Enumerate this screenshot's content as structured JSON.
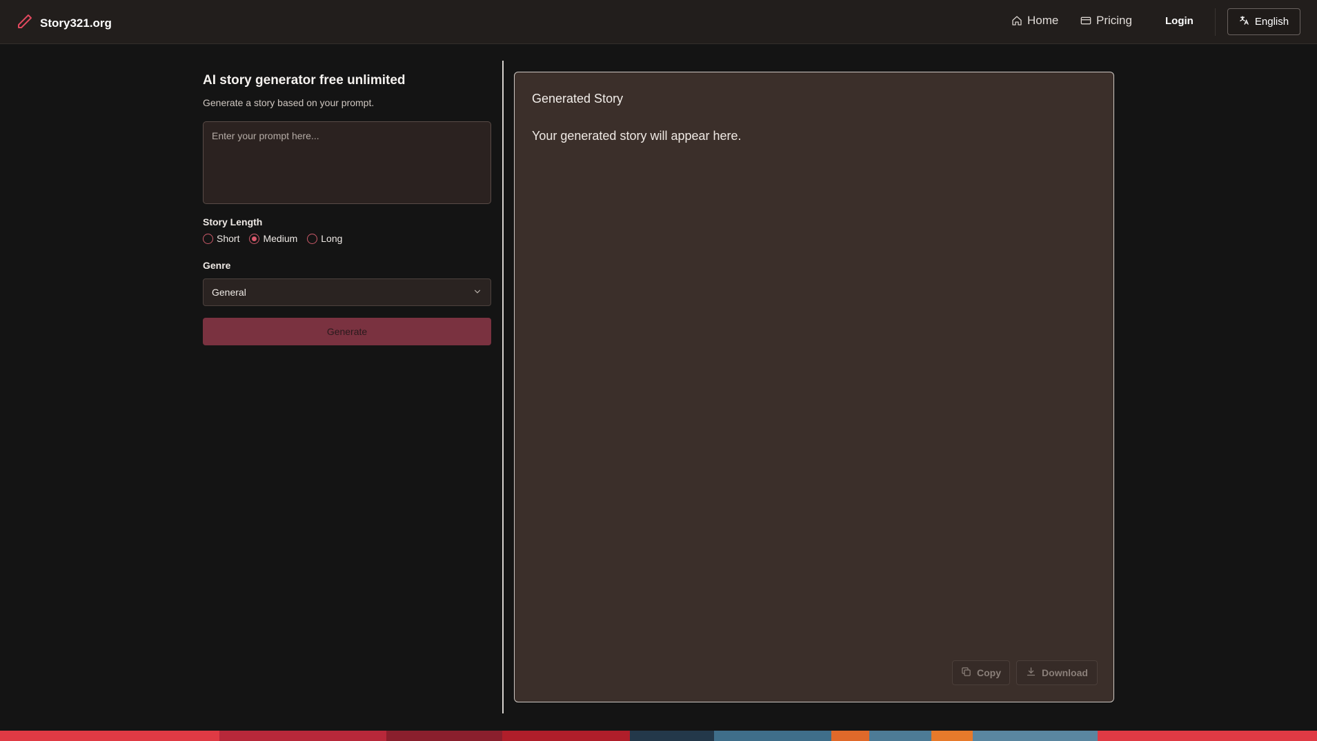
{
  "header": {
    "brand": "Story321.org",
    "nav": {
      "home": "Home",
      "pricing": "Pricing",
      "login": "Login",
      "language": "English"
    }
  },
  "generator": {
    "title": "AI story generator free unlimited",
    "subtitle": "Generate a story based on your prompt.",
    "prompt_placeholder": "Enter your prompt here...",
    "prompt_value": "",
    "length_label": "Story Length",
    "length_options": [
      "Short",
      "Medium",
      "Long"
    ],
    "length_selected": "Medium",
    "genre_label": "Genre",
    "genre_selected": "General",
    "generate_label": "Generate"
  },
  "output": {
    "title": "Generated Story",
    "placeholder_text": "Your generated story will appear here.",
    "copy_label": "Copy",
    "download_label": "Download"
  },
  "colors": {
    "accent": "#d9586c",
    "button_disabled": "#7a3240",
    "panel": "#3b2f2a",
    "background": "#141414"
  }
}
